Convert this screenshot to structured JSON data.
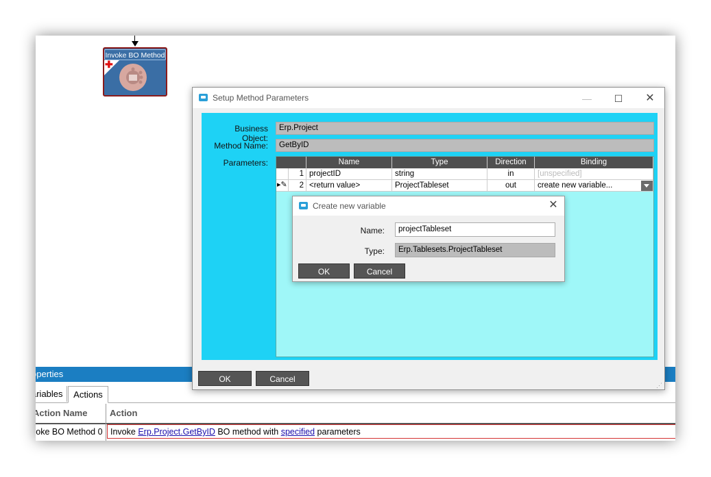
{
  "canvas": {
    "activity_title": "Invoke BO Method"
  },
  "properties": {
    "header": "operties",
    "tabs": [
      "ariables",
      "Actions"
    ],
    "columns": [
      "Action Name",
      "Action"
    ],
    "row": {
      "name": "voke BO Method 0",
      "action_prefix": "Invoke ",
      "action_link": "Erp.Project.GetByID",
      "action_middle": " BO method with ",
      "action_link2": "specified",
      "action_suffix": " parameters"
    }
  },
  "setup_dialog": {
    "title": "Setup Method Parameters",
    "window_buttons": {
      "minimize": "—",
      "maximize": "☐",
      "close": "✕"
    },
    "business_object_label": "Business Object:",
    "business_object_value": "Erp.Project",
    "method_name_label": "Method Name:",
    "method_name_value": "GetByID",
    "parameters_label": "Parameters:",
    "columns": [
      "Name",
      "Type",
      "Direction",
      "Binding"
    ],
    "rows": [
      {
        "num": "1",
        "name": "projectID",
        "type": "string",
        "direction": "in",
        "binding": "[unspecified]"
      },
      {
        "num": "2",
        "name": "<return value>",
        "type": "ProjectTableset",
        "direction": "out",
        "binding": "create new variable..."
      }
    ],
    "row_indicator": "▸✎",
    "ok_label": "OK",
    "cancel_label": "Cancel"
  },
  "create_var_dialog": {
    "title": "Create new variable",
    "close": "✕",
    "name_label": "Name:",
    "name_value": "projectTableset",
    "type_label": "Type:",
    "type_value": "Erp.Tablesets.ProjectTableset",
    "ok_label": "OK",
    "cancel_label": "Cancel"
  },
  "colors": {
    "accent": "#1ed2f5",
    "table_bg": "#9ff7f8",
    "props_bar": "#1b7ec2",
    "button": "#555555"
  }
}
